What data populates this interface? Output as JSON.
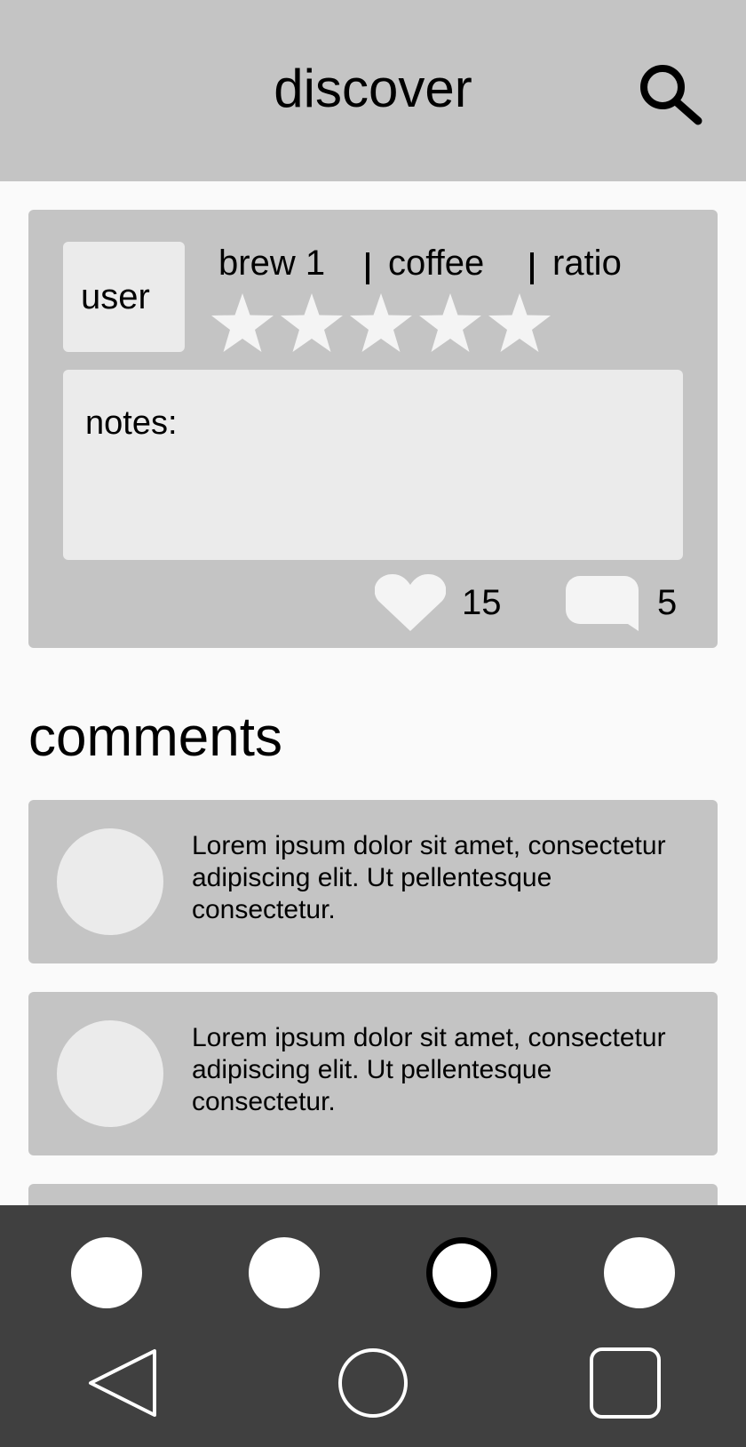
{
  "header": {
    "title": "discover",
    "search_icon": "search-icon"
  },
  "post": {
    "user_label": "user",
    "brew": "brew 1",
    "coffee": "coffee",
    "ratio": "ratio",
    "rating": 5,
    "rating_max": 5,
    "notes_label": "notes:",
    "likes": "15",
    "comments": "5",
    "icons": [
      "heart-icon",
      "comment-bubble-icon",
      "star-icon"
    ]
  },
  "comments_section": {
    "title": "comments",
    "items": [
      {
        "text": "Lorem ipsum dolor sit amet, consectetur adipiscing elit. Ut pellentesque consectetur."
      },
      {
        "text": "Lorem ipsum dolor sit amet, consectetur adipiscing elit. Ut pellentesque consectetur."
      },
      {
        "text": ""
      }
    ]
  },
  "bottom_nav": {
    "items": 4,
    "active_index": 2,
    "system_icons": [
      "back-triangle-icon",
      "home-circle-icon",
      "recents-square-icon"
    ]
  },
  "colors": {
    "header_bg": "#c4c4c4",
    "card_bg": "#c4c4c4",
    "inner_bg": "#ebebeb",
    "page_bg": "#fafafa",
    "nav_bg": "#404040",
    "star_color": "#f4f4f4"
  }
}
